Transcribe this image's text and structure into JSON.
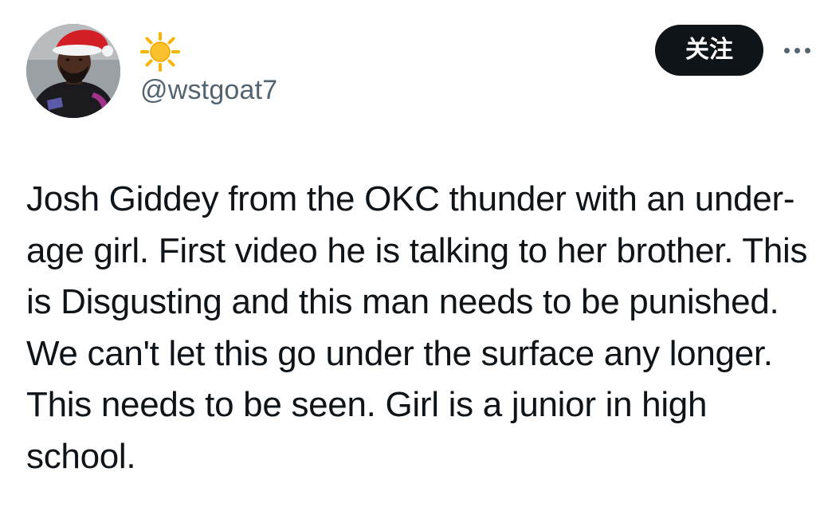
{
  "tweet": {
    "author": {
      "display_name_icon": "sun-emoji-icon",
      "handle": "@wstgoat7",
      "avatar": "avatar-image"
    },
    "follow_label": "关注",
    "more_icon": "more-options-icon",
    "text": "Josh Giddey from the OKC thunder with an under-age girl. First video he is talking to her brother. This is Disgusting and this man needs to be punished. We can't let this go under the surface any longer. This needs to be seen. Girl is a junior in high school."
  },
  "colors": {
    "text_primary": "#0f1419",
    "text_secondary": "#536471",
    "button_bg": "#0f1419",
    "button_text": "#ffffff",
    "background": "#ffffff",
    "sun": "#f7b500"
  }
}
